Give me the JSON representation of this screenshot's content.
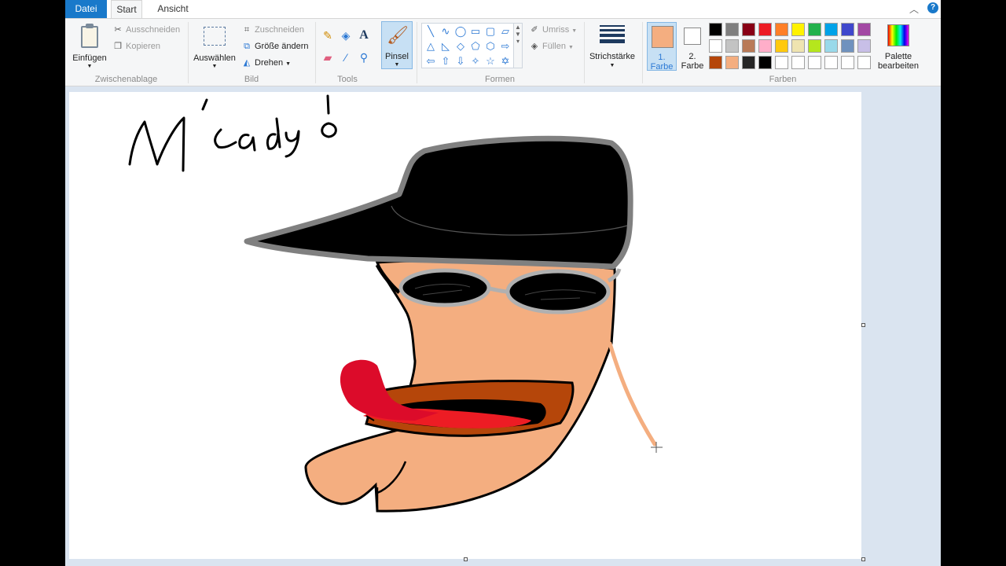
{
  "tabs": {
    "file": "Datei",
    "start": "Start",
    "view": "Ansicht"
  },
  "clipboard": {
    "paste": "Einfügen",
    "cut": "Ausschneiden",
    "copy": "Kopieren",
    "group_label": "Zwischenablage"
  },
  "image": {
    "select": "Auswählen",
    "crop": "Zuschneiden",
    "resize": "Größe ändern",
    "rotate": "Drehen",
    "group_label": "Bild"
  },
  "tools": {
    "group_label": "Tools",
    "brush": "Pinsel",
    "text_icon": "A"
  },
  "shapes": {
    "outline": "Umriss",
    "fill": "Füllen",
    "group_label": "Formen"
  },
  "stroke": {
    "label": "Strichstärke"
  },
  "colors": {
    "color1_line1": "1.",
    "color1_line2": "Farbe",
    "color2_line1": "2.",
    "color2_line2": "Farbe",
    "edit_line1": "Palette",
    "edit_line2": "bearbeiten",
    "group_label": "Farben",
    "color1_value": "#f4ae80",
    "color2_value": "#ffffff",
    "palette": [
      "#000000",
      "#7f7f7f",
      "#880015",
      "#ed1c24",
      "#ff7f27",
      "#fff200",
      "#22b14c",
      "#00a2e8",
      "#3f48cc",
      "#a349a4",
      "#ffffff",
      "#c3c3c3",
      "#b97a57",
      "#ffaec9",
      "#ffc90e",
      "#efe4b0",
      "#b5e61d",
      "#99d9ea",
      "#7092be",
      "#c8bfe7",
      "#b5460a",
      "#f4ae80",
      "#262626",
      "#000000",
      "#ffffff",
      "#ffffff",
      "#ffffff",
      "#ffffff",
      "#ffffff",
      "#ffffff"
    ]
  }
}
